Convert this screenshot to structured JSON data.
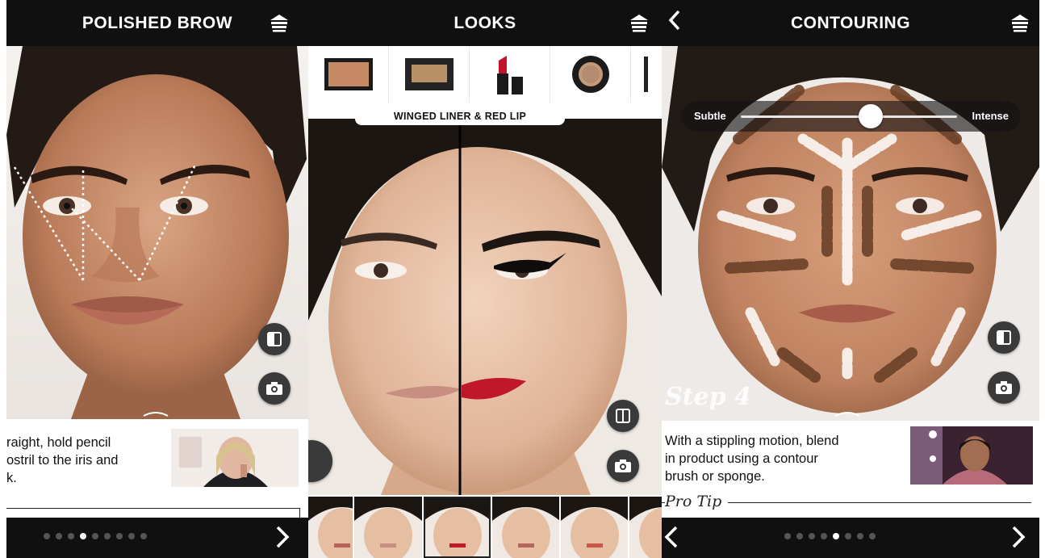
{
  "panels": {
    "brow": {
      "title": "POLISHED BROW",
      "instructions": [
        "raight, hold pencil",
        "ostril to the iris and",
        "k."
      ],
      "dots_total": 9,
      "dots_active": 3,
      "icons": {
        "bag": "shopping-bag-icon",
        "compare": "compare-icon",
        "camera": "camera-icon",
        "next": "chevron-right-icon"
      }
    },
    "looks": {
      "title": "LOOKS",
      "look_name": "WINGED LINER & RED LIP",
      "products": [
        "bronzer-compact",
        "powder-compact",
        "red-lipstick",
        "cream-concealer-pot",
        "eyeliner-pencil"
      ],
      "filmstrip_count": 6,
      "filmstrip_active": 2,
      "icons": {
        "bag": "shopping-bag-icon",
        "compare": "compare-icon",
        "camera": "camera-icon"
      }
    },
    "contour": {
      "title": "CONTOURING",
      "slider_min_label": "Subtle",
      "slider_max_label": "Intense",
      "slider_value": 0.6,
      "step_title": "Step 4",
      "instructions": [
        "With a stippling motion, blend",
        "in product using a contour",
        "brush or sponge."
      ],
      "pro_tip_label": "Pro Tip",
      "dots_total": 8,
      "dots_active": 4,
      "icons": {
        "back": "chevron-left-icon",
        "bag": "shopping-bag-icon",
        "compare": "compare-icon",
        "camera": "camera-icon",
        "next": "chevron-right-icon"
      }
    }
  },
  "colors": {
    "bar": "#101010",
    "button": "#3a3a3a"
  }
}
